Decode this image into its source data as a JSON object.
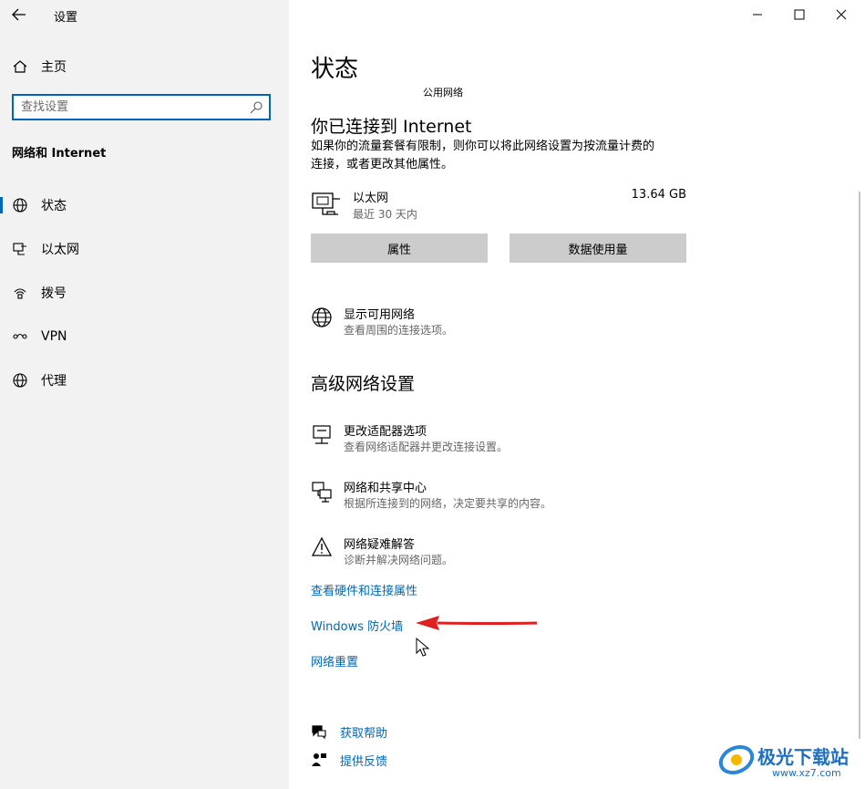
{
  "window": {
    "title": "设置",
    "controls": [
      "minimize",
      "maximize",
      "close"
    ]
  },
  "sidebar": {
    "home_label": "主页",
    "search_placeholder": "查找设置",
    "section_title": "网络和 Internet",
    "items": [
      {
        "label": "状态",
        "icon": "globe-icon",
        "selected": true
      },
      {
        "label": "以太网",
        "icon": "ethernet-icon"
      },
      {
        "label": "拨号",
        "icon": "dialup-icon"
      },
      {
        "label": "VPN",
        "icon": "vpn-icon"
      },
      {
        "label": "代理",
        "icon": "globe-icon"
      }
    ]
  },
  "main": {
    "title": "状态",
    "network_type": "公用网络",
    "connected_heading": "你已连接到 Internet",
    "connected_desc_line1": "如果你的流量套餐有限制，则你可以将此网络设置为按流量计费的",
    "connected_desc_line2": "连接，或者更改其他属性。",
    "adapter": {
      "name": "以太网",
      "period": "最近 30 天内",
      "usage": "13.64 GB"
    },
    "buttons": {
      "properties": "属性",
      "data_usage": "数据使用量"
    },
    "show_networks": {
      "title": "显示可用网络",
      "subtitle": "查看周围的连接选项。"
    },
    "advanced_heading": "高级网络设置",
    "advanced_items": [
      {
        "title": "更改适配器选项",
        "subtitle": "查看网络适配器并更改连接设置。",
        "icon": "adapter-icon"
      },
      {
        "title": "网络和共享中心",
        "subtitle": "根据所连接到的网络，决定要共享的内容。",
        "icon": "sharing-icon"
      },
      {
        "title": "网络疑难解答",
        "subtitle": "诊断并解决网络问题。",
        "icon": "warning-icon"
      }
    ],
    "links": {
      "hardware": "查看硬件和连接属性",
      "firewall": "Windows 防火墙",
      "reset": "网络重置"
    },
    "help": {
      "get_help": "获取帮助",
      "feedback": "提供反馈"
    }
  },
  "watermark": {
    "text": "极光下载站",
    "url": "www.xz7.com"
  },
  "colors": {
    "accent": "#0067b8",
    "sidebar_bg": "#f2f2f2",
    "button_bg": "#cccccc",
    "arrow": "#e02020"
  }
}
